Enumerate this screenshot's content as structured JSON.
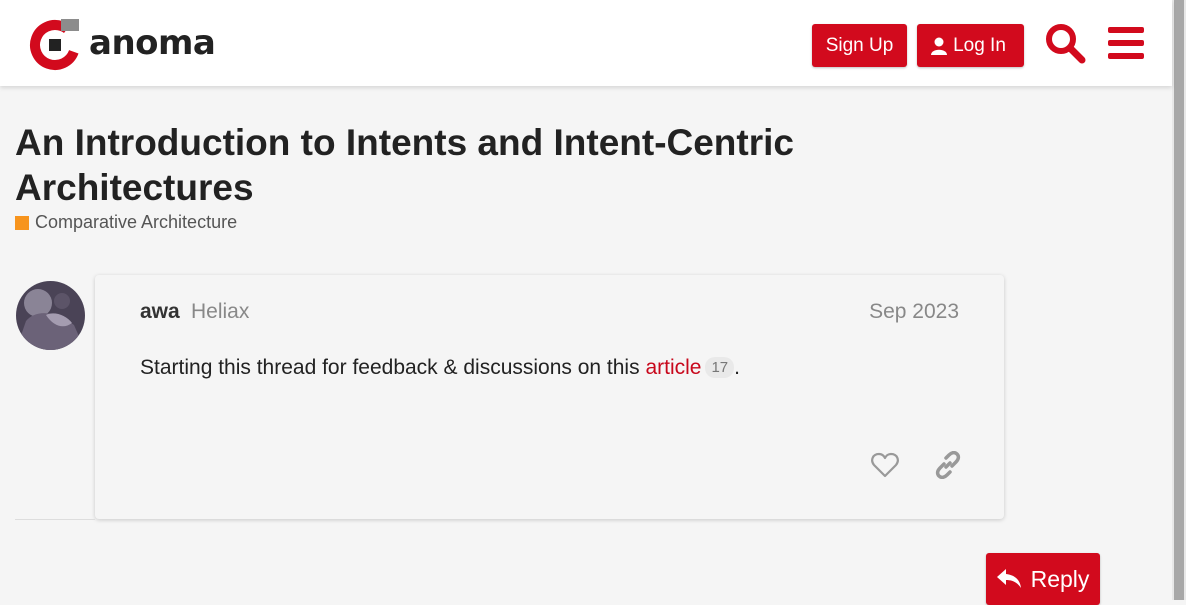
{
  "header": {
    "brand_name": "anoma",
    "signup_label": "Sign Up",
    "login_label": "Log In",
    "icons": [
      "anoma-logo-icon",
      "user-icon",
      "search-icon",
      "hamburger-menu-icon"
    ]
  },
  "topic": {
    "title": "An Introduction to Intents and Intent-Centric Architectures",
    "category": "Comparative Architecture",
    "category_color": "#f7941d"
  },
  "post": {
    "username": "awa",
    "user_title": "Heliax",
    "date": "Sep 2023",
    "body_prefix": "Starting this thread for feedback & discussions on this ",
    "link_text": "article",
    "link_clicks": "17",
    "body_suffix": ".",
    "icons": [
      "heart-icon",
      "link-icon"
    ]
  },
  "footer": {
    "reply_label": "Reply",
    "reply_icon": "reply-arrow-icon"
  },
  "colors": {
    "accent": "#d20a1d",
    "link": "#c8081c",
    "background": "#f5f5f5"
  }
}
